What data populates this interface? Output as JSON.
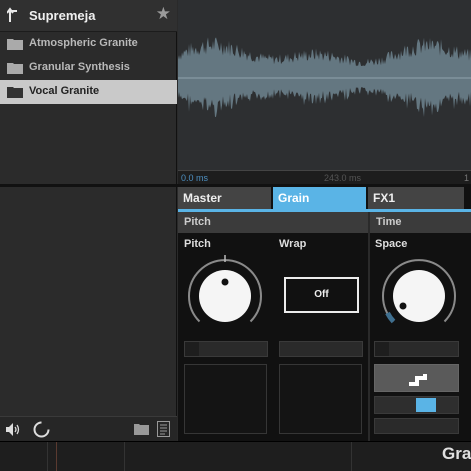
{
  "browser": {
    "title": "Supremeja",
    "items": [
      {
        "label": "Atmospheric Granite",
        "selected": false
      },
      {
        "label": "Granular Synthesis",
        "selected": false
      },
      {
        "label": "Vocal Granite",
        "selected": true
      }
    ],
    "header_icons": [
      "back-icon",
      "star-icon"
    ],
    "footer_icons": [
      "speaker-icon",
      "spinner-icon",
      "folder-icon",
      "file-icon"
    ]
  },
  "waveform": {
    "time_start": "0.0 ms",
    "time_mid": "243.0 ms",
    "time_end": "1"
  },
  "tabs": [
    {
      "label": "Master",
      "active": false
    },
    {
      "label": "Grain",
      "active": true
    },
    {
      "label": "FX1",
      "active": false
    }
  ],
  "sections": {
    "pitch": {
      "header": "Pitch",
      "knob_label": "Pitch",
      "wrap_label": "Wrap",
      "wrap_value": "Off",
      "knob_value": 0.5
    },
    "time": {
      "header": "Time",
      "knob_label": "Space",
      "knob_value": 0.08,
      "slider_value": 0.65
    }
  },
  "bottom": {
    "title": "Gra"
  },
  "colors": {
    "accent": "#5ab4e6",
    "selected_item": "#c9c9c9",
    "waveform": "#6e848f"
  }
}
